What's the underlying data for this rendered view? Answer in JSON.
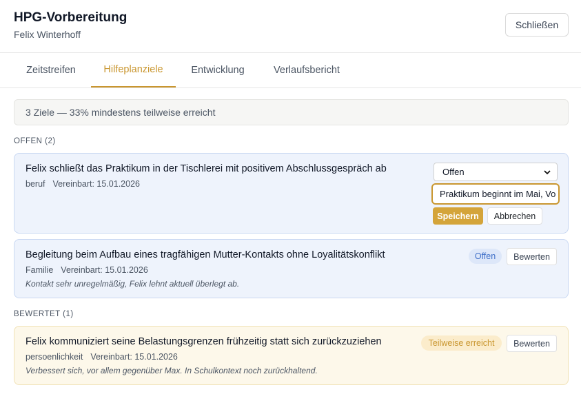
{
  "header": {
    "title": "HPG-Vorbereitung",
    "subtitle": "Felix Winterhoff",
    "close_label": "Schließen"
  },
  "tabs": [
    {
      "label": "Zeitstreifen",
      "active": false
    },
    {
      "label": "Hilfeplanziele",
      "active": true
    },
    {
      "label": "Entwicklung",
      "active": false
    },
    {
      "label": "Verlaufsbericht",
      "active": false
    }
  ],
  "summary": "3 Ziele — 33% mindestens teilweise erreicht",
  "sections": {
    "open_label": "OFFEN (2)",
    "rated_label": "BEWERTET (1)"
  },
  "goals": [
    {
      "title": "Felix schließt das Praktikum in der Tischlerei mit positivem Abschlussgespräch ab",
      "category": "beruf",
      "agreed": "Vereinbart: 15.01.2026",
      "editing": {
        "status_value": "Offen",
        "note_value": "Praktikum beginnt im Mai, Vo",
        "save_label": "Speichern",
        "cancel_label": "Abbrechen"
      }
    },
    {
      "title": "Begleitung beim Aufbau eines tragfähigen Mutter-Kontakts ohne Loyalitätskonflikt",
      "category": "Familie",
      "agreed": "Vereinbart: 15.01.2026",
      "note": "Kontakt sehr unregelmäßig, Felix lehnt aktuell überlegt ab.",
      "status": "Offen",
      "rate_label": "Bewerten"
    },
    {
      "title": "Felix kommuniziert seine Belastungsgrenzen frühzeitig statt sich zurückzuziehen",
      "category": "persoenlichkeit",
      "agreed": "Vereinbart: 15.01.2026",
      "note": "Verbessert sich, vor allem gegenüber Max. In Schulkontext noch zurückhaltend.",
      "status": "Teilweise erreicht",
      "rate_label": "Bewerten"
    }
  ],
  "colors": {
    "accent": "#c9962f",
    "open_card_bg": "#eef3fc",
    "rated_card_bg": "#fdf8ea",
    "open_badge": "#3f6fc8"
  }
}
